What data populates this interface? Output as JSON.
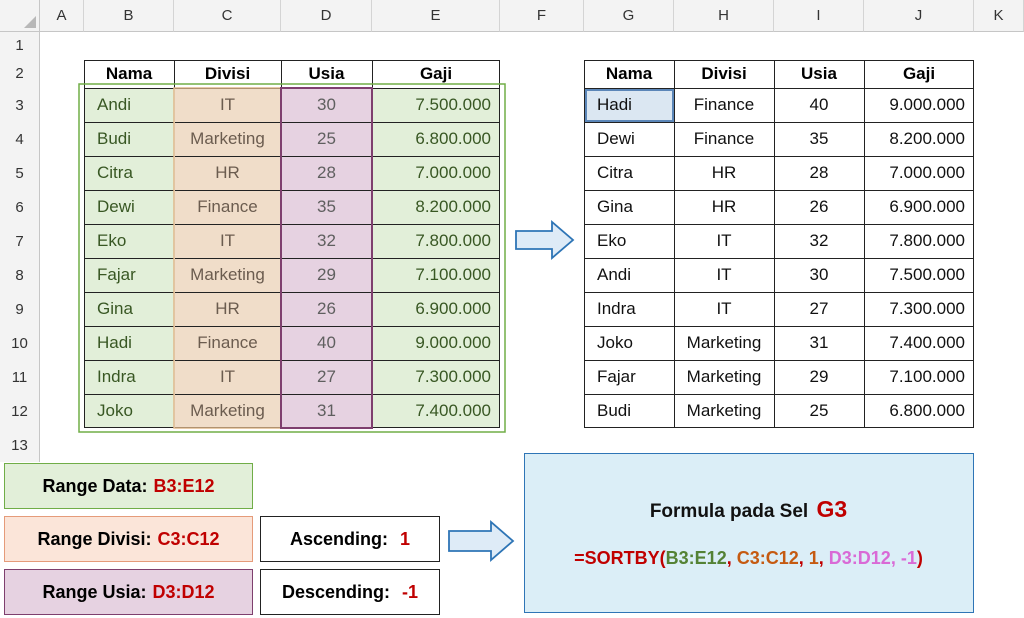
{
  "column_headers": [
    "A",
    "B",
    "C",
    "D",
    "E",
    "F",
    "G",
    "H",
    "I",
    "J",
    "K"
  ],
  "row_headers": [
    "1",
    "2",
    "3",
    "4",
    "5",
    "6",
    "7",
    "8",
    "9",
    "10",
    "11",
    "12",
    "13"
  ],
  "source_table": {
    "headers": [
      "Nama",
      "Divisi",
      "Usia",
      "Gaji"
    ],
    "rows": [
      [
        "Andi",
        "IT",
        "30",
        "7.500.000"
      ],
      [
        "Budi",
        "Marketing",
        "25",
        "6.800.000"
      ],
      [
        "Citra",
        "HR",
        "28",
        "7.000.000"
      ],
      [
        "Dewi",
        "Finance",
        "35",
        "8.200.000"
      ],
      [
        "Eko",
        "IT",
        "32",
        "7.800.000"
      ],
      [
        "Fajar",
        "Marketing",
        "29",
        "7.100.000"
      ],
      [
        "Gina",
        "HR",
        "26",
        "6.900.000"
      ],
      [
        "Hadi",
        "Finance",
        "40",
        "9.000.000"
      ],
      [
        "Indra",
        "IT",
        "27",
        "7.300.000"
      ],
      [
        "Joko",
        "Marketing",
        "31",
        "7.400.000"
      ]
    ]
  },
  "result_table": {
    "headers": [
      "Nama",
      "Divisi",
      "Usia",
      "Gaji"
    ],
    "rows": [
      [
        "Hadi",
        "Finance",
        "40",
        "9.000.000"
      ],
      [
        "Dewi",
        "Finance",
        "35",
        "8.200.000"
      ],
      [
        "Citra",
        "HR",
        "28",
        "7.000.000"
      ],
      [
        "Gina",
        "HR",
        "26",
        "6.900.000"
      ],
      [
        "Eko",
        "IT",
        "32",
        "7.800.000"
      ],
      [
        "Andi",
        "IT",
        "30",
        "7.500.000"
      ],
      [
        "Indra",
        "IT",
        "27",
        "7.300.000"
      ],
      [
        "Joko",
        "Marketing",
        "31",
        "7.400.000"
      ],
      [
        "Fajar",
        "Marketing",
        "29",
        "7.100.000"
      ],
      [
        "Budi",
        "Marketing",
        "25",
        "6.800.000"
      ]
    ]
  },
  "labels": {
    "range_data": {
      "label": "Range Data:",
      "value": "B3:E12"
    },
    "range_divisi": {
      "label": "Range Divisi:",
      "value": "C3:C12"
    },
    "range_usia": {
      "label": "Range Usia:",
      "value": "D3:D12"
    },
    "ascending": {
      "label": "Ascending:",
      "value": "1"
    },
    "descending": {
      "label": "Descending:",
      "value": "-1"
    }
  },
  "formula_box": {
    "title": "Formula pada Sel",
    "cell": "G3",
    "parts": {
      "fn": "=SORTBY(",
      "arg1": "B3:E12",
      "sep1": ", ",
      "arg2": "C3:C12",
      "sep2": ", ",
      "arg3": "1",
      "sep3": ", ",
      "arg4": "D3:D12, -1",
      "close": ")"
    }
  },
  "colors": {
    "green_fill": "#e2efd9",
    "orange_fill": "#f0ddc9",
    "purple_fill": "#e6d2e1",
    "green_border": "#70ad47",
    "purple_border": "#7e3f6e",
    "arrow_fill": "#deebf7",
    "arrow_stroke": "#2e75b6",
    "formula_bg": "#dbeef7",
    "selected_cell_fill": "#dbe7f2",
    "selected_cell_border": "#5b86b8",
    "accent_red": "#c00000"
  }
}
